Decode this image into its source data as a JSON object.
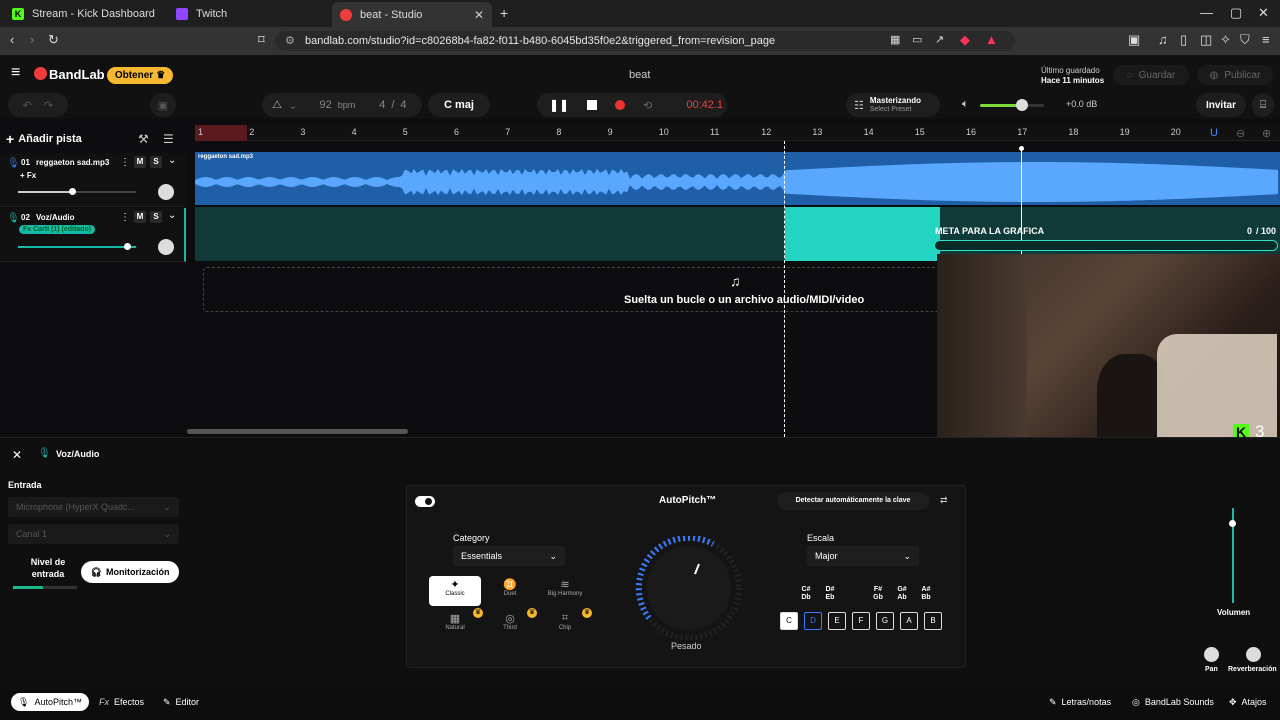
{
  "browser": {
    "tabs": [
      {
        "title": "Stream - Kick Dashboard",
        "color": "#53fc18"
      },
      {
        "title": "Twitch",
        "color": "#9146ff"
      },
      {
        "title": "beat - Studio",
        "color": "#f03c3c"
      }
    ],
    "url": "bandlab.com/studio?id=c80268b4-fa82-f011-b480-6045bd35f0e2&triggered_from=revision_page",
    "new_tab": "+"
  },
  "header": {
    "logo": "BandLab",
    "obtener_label": "Obtener",
    "project_title": "beat",
    "last_saved_label": "Último guardado",
    "last_saved_time": "Hace 11 minutos",
    "save_label": "Guardar",
    "publish_label": "Publicar"
  },
  "toolbar": {
    "bpm_value": "92",
    "bpm_label": "bpm",
    "time_sig_num": "4",
    "time_sig_sep": "/",
    "time_sig_den": "4",
    "key": "C maj",
    "time": "00:42.1",
    "mastering_title": "Masterizando",
    "mastering_sub": "Select Preset",
    "volume_db": "+0.0 dB",
    "invite_label": "Invitar"
  },
  "tracks_panel": {
    "add_track_label": "Añadir pista"
  },
  "ruler": {
    "bars": [
      "1",
      "2",
      "3",
      "4",
      "5",
      "6",
      "7",
      "8",
      "9",
      "10",
      "11",
      "12",
      "13",
      "14",
      "15",
      "16",
      "17",
      "18",
      "19",
      "20"
    ]
  },
  "tracks": [
    {
      "number": "01",
      "name": "reggaeton sad.mp3",
      "fx": "+ Fx",
      "mute": "M",
      "solo": "S",
      "clip_name": "reggaeton sad.mp3",
      "color": "#2f7bd1"
    },
    {
      "number": "02",
      "name": "Voz/Audio",
      "fx": "Fx Carti (1) (editado)",
      "mute": "M",
      "solo": "S",
      "color": "#19b9a9"
    }
  ],
  "drop_zone": {
    "text": "Suelta un bucle o un archivo audio/MIDI/video"
  },
  "overlay": {
    "goal_label": "META PARA LA GRAFICA",
    "goal_current": "0",
    "goal_total": "/ 100",
    "goal_progress": 0,
    "kick_count": "3"
  },
  "bottom": {
    "track_name": "Voz/Audio",
    "input_label": "Entrada",
    "input_device": "Microphone (HyperX Quadc...",
    "channel": "Canal 1",
    "input_level_label": "Nivel de entrada",
    "monitor_label": "Monitorización",
    "autopitch_title": "AutoPitch™",
    "detect_key_label": "Detectar automáticamente la clave",
    "category_label": "Category",
    "category_value": "Essentials",
    "presets": [
      {
        "name": "Classic",
        "icon": "✦",
        "premium": false
      },
      {
        "name": "Duet",
        "icon": "♊",
        "premium": false
      },
      {
        "name": "Big Harmony",
        "icon": "≋",
        "premium": false
      },
      {
        "name": "Natural",
        "icon": "▦",
        "premium": true
      },
      {
        "name": "Third",
        "icon": "◎",
        "premium": true
      },
      {
        "name": "Chip",
        "icon": "⌗",
        "premium": true
      }
    ],
    "weight_label": "Pesado",
    "scale_label": "Escala",
    "scale_value": "Major",
    "sharps": [
      {
        "top": "C#",
        "bottom": "Db"
      },
      {
        "top": "D#",
        "bottom": "Eb"
      },
      {
        "top": "F#",
        "bottom": "Gb"
      },
      {
        "top": "G#",
        "bottom": "Ab"
      },
      {
        "top": "A#",
        "bottom": "Bb"
      }
    ],
    "naturals": [
      "C",
      "D",
      "E",
      "F",
      "G",
      "A",
      "B"
    ],
    "volume_label": "Volumen",
    "pan_label": "Pan",
    "reverb_label": "Reverberación"
  },
  "footer": {
    "autopitch": "AutoPitch™",
    "effects": "Efectos",
    "editor": "Editor",
    "lyrics": "Letras/notas",
    "sounds": "BandLab Sounds",
    "shortcuts": "Atajos"
  }
}
